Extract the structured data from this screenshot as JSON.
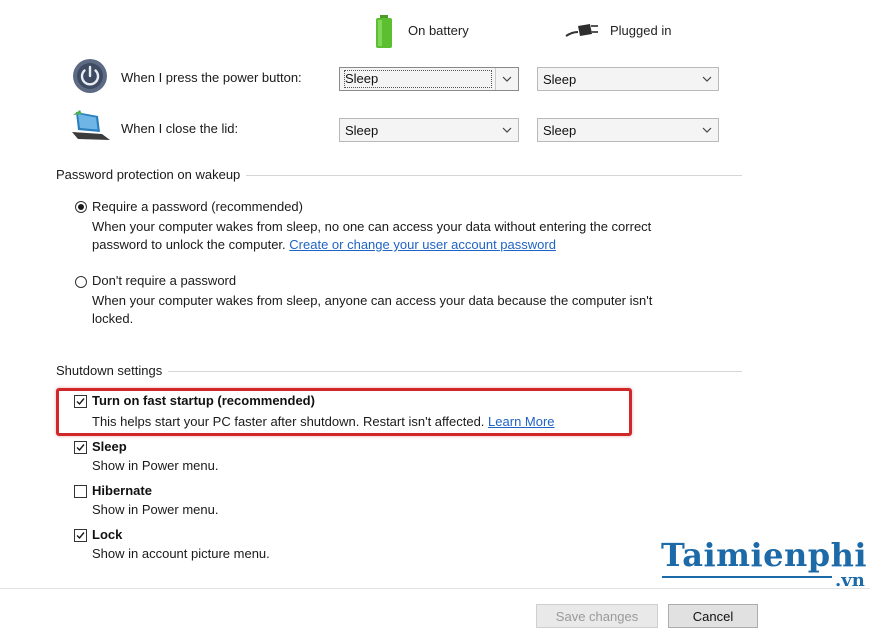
{
  "columns": {
    "on_battery": "On battery",
    "plugged_in": "Plugged in"
  },
  "power_button": {
    "label": "When I press the power button:",
    "battery_value": "Sleep",
    "plugged_value": "Sleep"
  },
  "lid": {
    "label": "When I close the lid:",
    "battery_value": "Sleep",
    "plugged_value": "Sleep"
  },
  "password_section": {
    "title": "Password protection on wakeup",
    "require": {
      "label": "Require a password (recommended)",
      "selected": true,
      "desc_line1": "When your computer wakes from sleep, no one can access your data without entering the correct",
      "desc_line2": "password to unlock the computer.",
      "link": "Create or change your user account password"
    },
    "dont_require": {
      "label": "Don't require a password",
      "selected": false,
      "desc_line1": "When your computer wakes from sleep, anyone can access your data because the computer isn't",
      "desc_line2": "locked."
    }
  },
  "shutdown_section": {
    "title": "Shutdown settings",
    "fast_startup": {
      "label": "Turn on fast startup (recommended)",
      "checked": true,
      "desc": "This helps start your PC faster after shutdown. Restart isn't affected.",
      "link": "Learn More"
    },
    "sleep": {
      "label": "Sleep",
      "checked": true,
      "desc": "Show in Power menu."
    },
    "hibernate": {
      "label": "Hibernate",
      "checked": false,
      "desc": "Show in Power menu."
    },
    "lock": {
      "label": "Lock",
      "checked": true,
      "desc": "Show in account picture menu."
    }
  },
  "watermark": {
    "main": "Taimienphi",
    "sub": ".vn"
  },
  "buttons": {
    "save": "Save changes",
    "cancel": "Cancel"
  },
  "colors": {
    "highlight": "#d0272b",
    "link": "#1f63c5",
    "watermark": "#1d6aa8"
  }
}
